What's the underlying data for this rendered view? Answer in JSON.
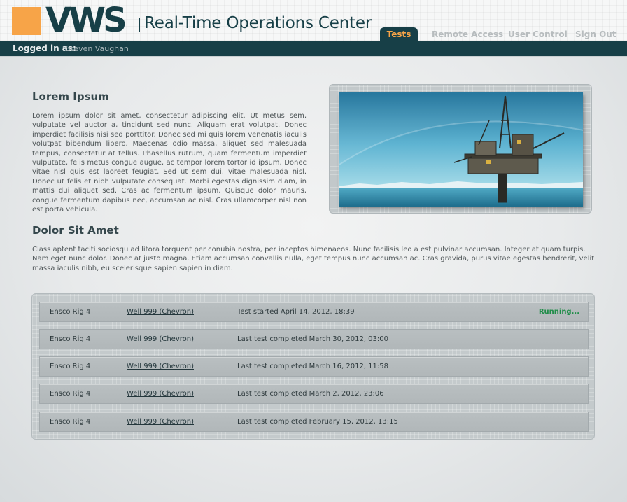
{
  "header": {
    "logo": "VWS",
    "title": "Real-Time Operations Center",
    "nav": [
      {
        "label": "Tests",
        "active": true
      },
      {
        "label": "Remote Access",
        "active": false
      },
      {
        "label": "User Control",
        "active": false
      },
      {
        "label": "Sign Out",
        "active": false
      }
    ]
  },
  "status_bar": {
    "logged_label": "Logged in as:",
    "user": "Steven Vaughan"
  },
  "section1": {
    "title": "Lorem Ipsum",
    "body": "Lorem ipsum dolor sit amet, consectetur adipiscing elit. Ut metus sem, vulputate vel auctor a, tincidunt sed nunc. Aliquam erat volutpat. Donec imperdiet facilisis nisi sed porttitor. Donec sed mi quis lorem venenatis iaculis volutpat bibendum libero. Maecenas odio massa, aliquet sed malesuada tempus, consectetur at tellus. Phasellus rutrum, quam fermentum imperdiet vulputate, felis metus congue augue, ac tempor lorem tortor id ipsum. Donec vitae nisl quis est laoreet feugiat. Sed ut sem dui, vitae malesuada nisl. Donec ut felis et nibh vulputate consequat. Morbi egestas dignissim diam, in mattis dui aliquet sed. Cras ac fermentum ipsum. Quisque dolor mauris, congue fermentum dapibus nec, accumsan ac nisl. Cras ullamcorper nisl non est porta vehicula."
  },
  "section2": {
    "title": "Dolor Sit Amet",
    "body": "Class aptent taciti sociosqu ad litora torquent per conubia nostra, per inceptos himenaeos. Nunc facilisis leo a est pulvinar accumsan. Integer at quam turpis. Nam eget nunc dolor. Donec at justo magna. Etiam accumsan convallis nulla, eget tempus nunc accumsan ac. Cras gravida, purus vitae egestas hendrerit, velit massa iaculis nibh, eu scelerisque sapien sapien in diam."
  },
  "tests": [
    {
      "rig": "Ensco Rig 4",
      "well": "Well 999 (Chevron)",
      "status": "Test started April 14, 2012, 18:39",
      "state": "Running..."
    },
    {
      "rig": "Ensco Rig 4",
      "well": "Well 999 (Chevron)",
      "status": "Last test completed March 30, 2012, 03:00",
      "state": ""
    },
    {
      "rig": "Ensco Rig 4",
      "well": "Well 999 (Chevron)",
      "status": "Last test completed March 16, 2012, 11:58",
      "state": ""
    },
    {
      "rig": "Ensco Rig 4",
      "well": "Well 999 (Chevron)",
      "status": "Last test completed March 2, 2012, 23:06",
      "state": ""
    },
    {
      "rig": "Ensco Rig 4",
      "well": "Well 999 (Chevron)",
      "status": "Last test completed February 15, 2012, 13:15",
      "state": ""
    }
  ],
  "colors": {
    "brand_dark": "#173f47",
    "brand_orange": "#f7a448",
    "running_green": "#1f8d48"
  }
}
